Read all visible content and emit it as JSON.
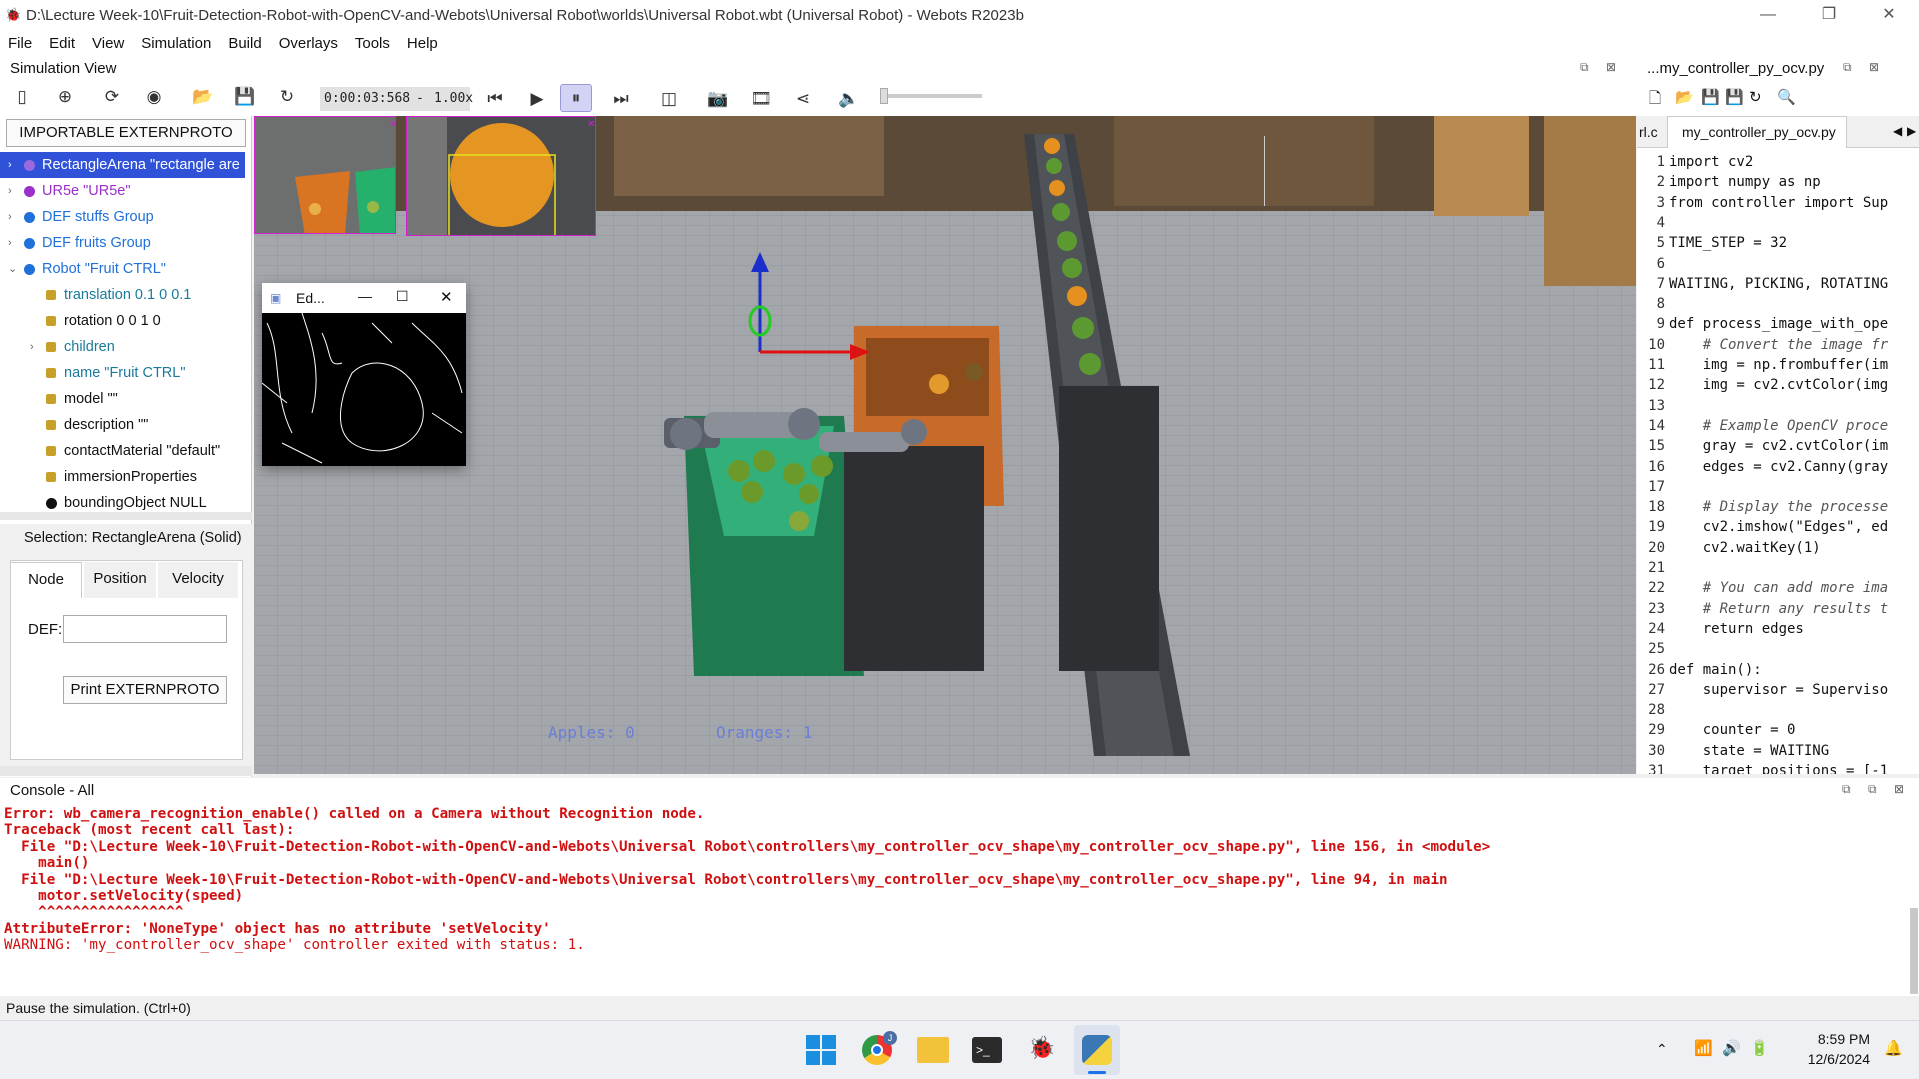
{
  "window": {
    "title": "D:\\Lecture Week-10\\Fruit-Detection-Robot-with-OpenCV-and-Webots\\Universal Robot\\worlds\\Universal Robot.wbt (Universal Robot) - Webots R2023b",
    "minimize": "—",
    "maximize": "❐",
    "close": "✕"
  },
  "menu": [
    "File",
    "Edit",
    "View",
    "Simulation",
    "Build",
    "Overlays",
    "Tools",
    "Help"
  ],
  "simulation_view": {
    "title": "Simulation View",
    "time": "0:00:03:568",
    "speed": "1.00x",
    "speed_sep": "-"
  },
  "scene_tree": {
    "importable_button": "IMPORTABLE EXTERNPROTO",
    "items": [
      {
        "label": "RectangleArena \"rectangle are",
        "color": "#2a46c8",
        "selected": true,
        "arrow": "›",
        "indent": 0,
        "icon": "dot"
      },
      {
        "label": "UR5e \"UR5e\"",
        "color": "#9b2fc8",
        "arrow": "›",
        "indent": 0,
        "icon": "dot"
      },
      {
        "label": "DEF stuffs Group",
        "color": "#1f70d8",
        "arrow": "›",
        "indent": 0,
        "icon": "dot"
      },
      {
        "label": "DEF fruits Group",
        "color": "#1f70d8",
        "arrow": "›",
        "indent": 0,
        "icon": "dot"
      },
      {
        "label": "Robot \"Fruit CTRL\"",
        "color": "#1f70d8",
        "arrow": "⌄",
        "indent": 0,
        "icon": "dot"
      },
      {
        "label": "translation 0.1 0 0.1",
        "color": "#1a7a9a",
        "indent": 1,
        "icon": "sq"
      },
      {
        "label": "rotation 0 0 1 0",
        "color": "#111",
        "indent": 1,
        "icon": "sq"
      },
      {
        "label": "children",
        "color": "#1a7a9a",
        "arrow": "›",
        "indent": 1,
        "icon": "sq"
      },
      {
        "label": "name \"Fruit CTRL\"",
        "color": "#1a7a9a",
        "indent": 1,
        "icon": "sq"
      },
      {
        "label": "model \"\"",
        "color": "#111",
        "indent": 1,
        "icon": "sq"
      },
      {
        "label": "description \"\"",
        "color": "#111",
        "indent": 1,
        "icon": "sq"
      },
      {
        "label": "contactMaterial \"default\"",
        "color": "#111",
        "indent": 1,
        "icon": "sq"
      },
      {
        "label": "immersionProperties",
        "color": "#111",
        "indent": 1,
        "icon": "sq"
      },
      {
        "label": "boundingObject NULL",
        "color": "#111",
        "indent": 1,
        "icon": "dot"
      }
    ]
  },
  "field_editor": {
    "selection": "Selection: RectangleArena (Solid)",
    "tabs": [
      "Node",
      "Position",
      "Velocity"
    ],
    "def_label": "DEF:",
    "def_value": "",
    "print_button": "Print EXTERNPROTO"
  },
  "edges_window": {
    "title": "Ed...",
    "minimize": "—",
    "maximize": "☐",
    "close": "✕"
  },
  "overlay": {
    "apples": "Apples: 0",
    "oranges": "Oranges: 1"
  },
  "editor": {
    "title": "...my_controller_py_ocv.py",
    "tab_prev": "rl.c",
    "tab_active": "my_controller_py_ocv.py",
    "lines": [
      {
        "n": "1",
        "t": "import cv2"
      },
      {
        "n": "2",
        "t": "import numpy as np"
      },
      {
        "n": "3",
        "t": "from controller import Sup"
      },
      {
        "n": "4",
        "t": ""
      },
      {
        "n": "5",
        "t": "TIME_STEP = 32"
      },
      {
        "n": "6",
        "t": ""
      },
      {
        "n": "7",
        "t": "WAITING, PICKING, ROTATING"
      },
      {
        "n": "8",
        "t": ""
      },
      {
        "n": "9",
        "t": "def process_image_with_ope"
      },
      {
        "n": "10",
        "t": "    # Convert the image fr"
      },
      {
        "n": "11",
        "t": "    img = np.frombuffer(im"
      },
      {
        "n": "12",
        "t": "    img = cv2.cvtColor(img"
      },
      {
        "n": "13",
        "t": ""
      },
      {
        "n": "14",
        "t": "    # Example OpenCV proce"
      },
      {
        "n": "15",
        "t": "    gray = cv2.cvtColor(im"
      },
      {
        "n": "16",
        "t": "    edges = cv2.Canny(gray"
      },
      {
        "n": "17",
        "t": ""
      },
      {
        "n": "18",
        "t": "    # Display the processe"
      },
      {
        "n": "19",
        "t": "    cv2.imshow(\"Edges\", ed"
      },
      {
        "n": "20",
        "t": "    cv2.waitKey(1)"
      },
      {
        "n": "21",
        "t": ""
      },
      {
        "n": "22",
        "t": "    # You can add more ima"
      },
      {
        "n": "23",
        "t": "    # Return any results t"
      },
      {
        "n": "24",
        "t": "    return edges"
      },
      {
        "n": "25",
        "t": ""
      },
      {
        "n": "26",
        "t": "def main():"
      },
      {
        "n": "27",
        "t": "    supervisor = Superviso"
      },
      {
        "n": "28",
        "t": ""
      },
      {
        "n": "29",
        "t": "    counter = 0"
      },
      {
        "n": "30",
        "t": "    state = WAITING"
      },
      {
        "n": "31",
        "t": "    target_positions = [-1"
      }
    ]
  },
  "console": {
    "title": "Console - All",
    "lines": [
      {
        "t": "Error: wb_camera_recognition_enable() called on a Camera without Recognition node.",
        "bold": true
      },
      {
        "t": "Traceback (most recent call last):",
        "bold": true
      },
      {
        "t": "  File \"D:\\Lecture Week-10\\Fruit-Detection-Robot-with-OpenCV-and-Webots\\Universal Robot\\controllers\\my_controller_ocv_shape\\my_controller_ocv_shape.py\", line 156, in <module>",
        "bold": true
      },
      {
        "t": "    main()",
        "bold": true
      },
      {
        "t": "  File \"D:\\Lecture Week-10\\Fruit-Detection-Robot-with-OpenCV-and-Webots\\Universal Robot\\controllers\\my_controller_ocv_shape\\my_controller_ocv_shape.py\", line 94, in main",
        "bold": true
      },
      {
        "t": "    motor.setVelocity(speed)",
        "bold": true
      },
      {
        "t": "    ^^^^^^^^^^^^^^^^^",
        "bold": true
      },
      {
        "t": "AttributeError: 'NoneType' object has no attribute 'setVelocity'",
        "bold": true
      },
      {
        "t": "WARNING: 'my_controller_ocv_shape' controller exited with status: 1.",
        "bold": false
      }
    ]
  },
  "status": "Pause the simulation. (Ctrl+0)",
  "taskbar": {
    "time": "8:59 PM",
    "date": "12/6/2024",
    "chrome_badge": "J"
  }
}
